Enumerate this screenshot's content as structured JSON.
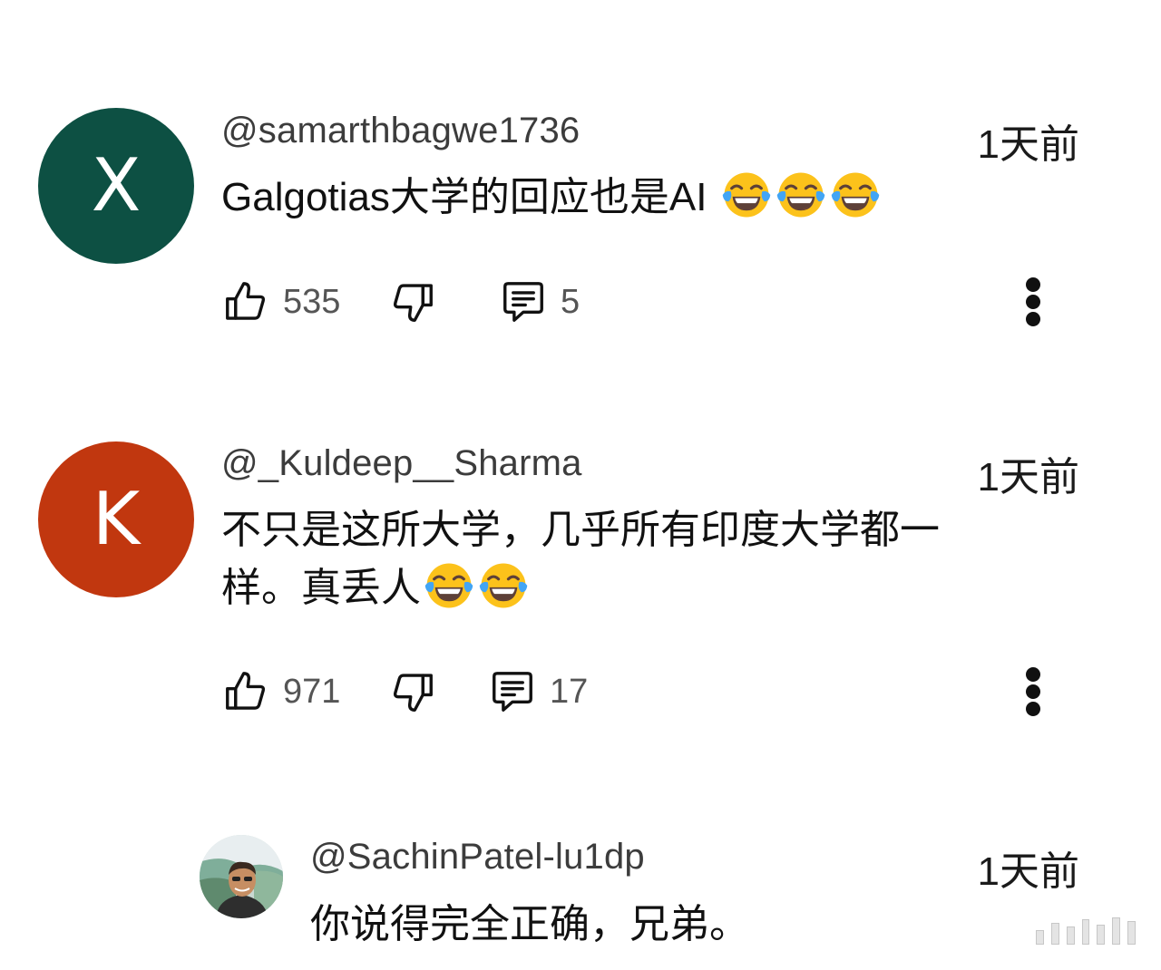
{
  "comments": [
    {
      "avatar": {
        "letter": "X",
        "color": "#0d5043"
      },
      "username": "@samarthbagwe1736",
      "time": "1天前",
      "text": "Galgotias大学的回应也是AI",
      "emoji_count": 3,
      "likes": "535",
      "replies": "5"
    },
    {
      "avatar": {
        "letter": "K",
        "color": "#c1370f"
      },
      "username": "@_Kuldeep__Sharma",
      "time": "1天前",
      "text_line1": "不只是这所大学，几乎所有印度大学都一",
      "text_line2": "样。真丢人",
      "emoji_count": 2,
      "likes": "971",
      "replies": "17"
    }
  ],
  "reply": {
    "avatar": {
      "kind": "photo"
    },
    "username": "@SachinPatel-lu1dp",
    "time": "1天前",
    "text": "你说得完全正确，兄弟。"
  },
  "icons": {
    "like": "thumbs-up-icon",
    "dislike": "thumbs-down-icon",
    "reply": "comment-icon",
    "more": "more-vertical-icon",
    "emoji": "face-with-tears-of-joy-icon"
  }
}
